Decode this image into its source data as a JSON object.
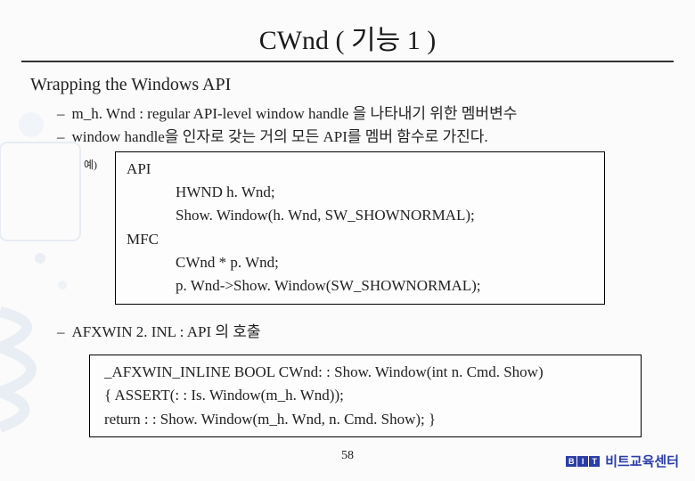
{
  "title": "CWnd ( 기능 1 )",
  "section_title": "Wrapping the Windows API",
  "bullet1": "m_h. Wnd : regular API-level window handle 을 나타내기 위한 멤버변수",
  "bullet2": "window handle을 인자로 갖는 거의 모든 API를 멤버 함수로 가진다.",
  "example_label": "예)",
  "box1": {
    "api_label": "API",
    "api_code": "HWND h. Wnd;\nShow. Window(h. Wnd, SW_SHOWNORMAL);",
    "mfc_label": "MFC",
    "mfc_code": "CWnd * p. Wnd;\np. Wnd->Show. Window(SW_SHOWNORMAL);"
  },
  "afxwin_line": "AFXWIN 2. INL  : API 의 호출",
  "box2_code": "_AFXWIN_INLINE BOOL CWnd: : Show. Window(int n. Cmd. Show)\n{ ASSERT(: : Is. Window(m_h. Wnd));\nreturn : : Show. Window(m_h. Wnd, n. Cmd. Show); }",
  "page_number": "58",
  "brand": {
    "logo_letters": [
      "B",
      "I",
      "T"
    ],
    "name": "비트교육센터"
  }
}
